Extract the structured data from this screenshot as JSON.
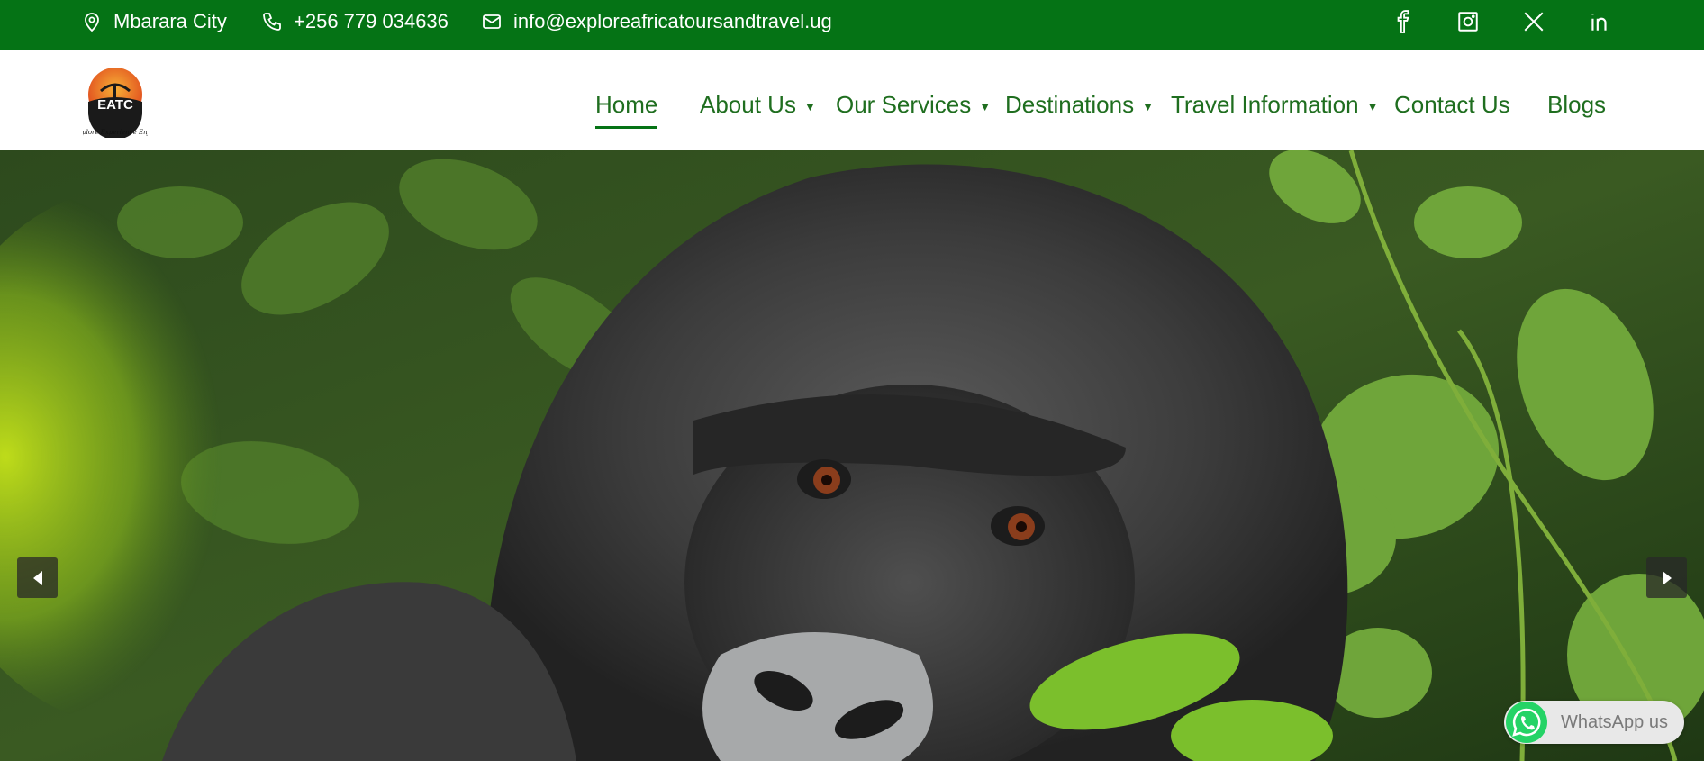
{
  "topbar": {
    "location": "Mbarara City",
    "phone": "+256 779 034636",
    "email": "info@exploreafricatoursandtravel.ug",
    "social_icons": [
      "facebook-icon",
      "instagram-icon",
      "x-icon",
      "linkedin-icon"
    ],
    "background": "#057315"
  },
  "header": {
    "logo_text": "EATC",
    "logo_tagline": "Explore Experience Enjoy",
    "nav": [
      {
        "label": "Home",
        "active": true
      },
      {
        "label": "About Us",
        "dropdown": true
      },
      {
        "label": "Our Services",
        "dropdown": true
      },
      {
        "label": "Destinations",
        "dropdown": true
      },
      {
        "label": "Travel Information",
        "dropdown": true
      },
      {
        "label": "Contact Us"
      },
      {
        "label": "Blogs"
      }
    ],
    "nav_color": "#1f6e1f"
  },
  "hero": {
    "prev_icon": "chevron-left-icon",
    "next_icon": "chevron-right-icon"
  },
  "whatsapp": {
    "label": "WhatsApp us",
    "color": "#25D366"
  }
}
